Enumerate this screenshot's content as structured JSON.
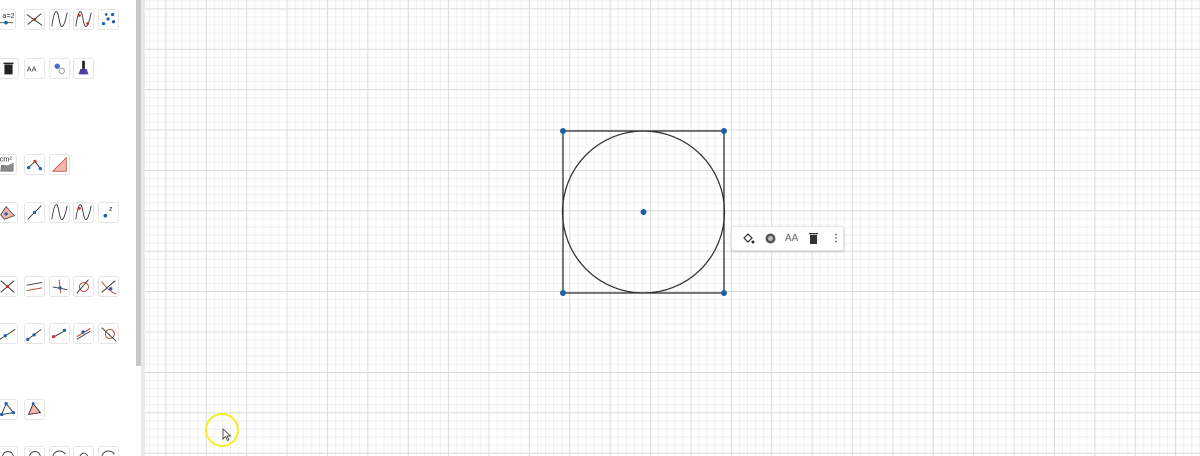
{
  "tool_panel": {
    "rows": [
      {
        "name": "row-1",
        "tools": [
          "slider-tool-icon",
          "intersect-lines-icon",
          "function-icon",
          "function-points-icon",
          "point-list-icon"
        ],
        "slider_label": "a=2"
      },
      {
        "name": "row-2",
        "tools": [
          "delete-icon",
          "text-size-icon",
          "show-hide-object-icon",
          "copy-style-icon"
        ],
        "text_label": "AA"
      },
      {
        "name": "row-3",
        "tools": [
          "area-icon",
          "relation-icon",
          "angle-icon"
        ],
        "area_label": "cm²"
      },
      {
        "name": "row-4",
        "tools": [
          "polygon-point-icon",
          "segment-point-icon",
          "function-icon",
          "function-points-icon",
          "complex-point-icon"
        ],
        "complex_label": "z"
      },
      {
        "name": "row-5",
        "tools": [
          "intersect-icon",
          "parallel-line-icon",
          "perpendicular-icon",
          "tangent-icon",
          "circle-intersect-icon"
        ]
      },
      {
        "name": "row-6",
        "tools": [
          "line-icon",
          "segment-icon",
          "midpoint-icon",
          "vector-icon",
          "circle-line-icon"
        ]
      },
      {
        "name": "row-7",
        "tools": [
          "triangle-icon",
          "polygon-icon"
        ]
      },
      {
        "name": "row-8",
        "tools": [
          "circle-icon",
          "circle-icon",
          "arc-icon",
          "curve-icon",
          "arc-icon"
        ]
      }
    ]
  },
  "style_bar": {
    "buttons": [
      "fill-color-icon",
      "point-style-icon",
      "text-size-icon",
      "delete-icon",
      "more-options-icon"
    ],
    "text_size_label": "AA",
    "more_label": "⋮"
  },
  "colors": {
    "point": "#1f5fa8",
    "line": "#333333",
    "grid_major": "#dcdcdc",
    "grid_minor": "#f0f0f0",
    "cursor_highlight": "#f2f024"
  },
  "construction": {
    "square": "square-abcd",
    "circle": "inscribed-circle",
    "center": "center-point"
  }
}
